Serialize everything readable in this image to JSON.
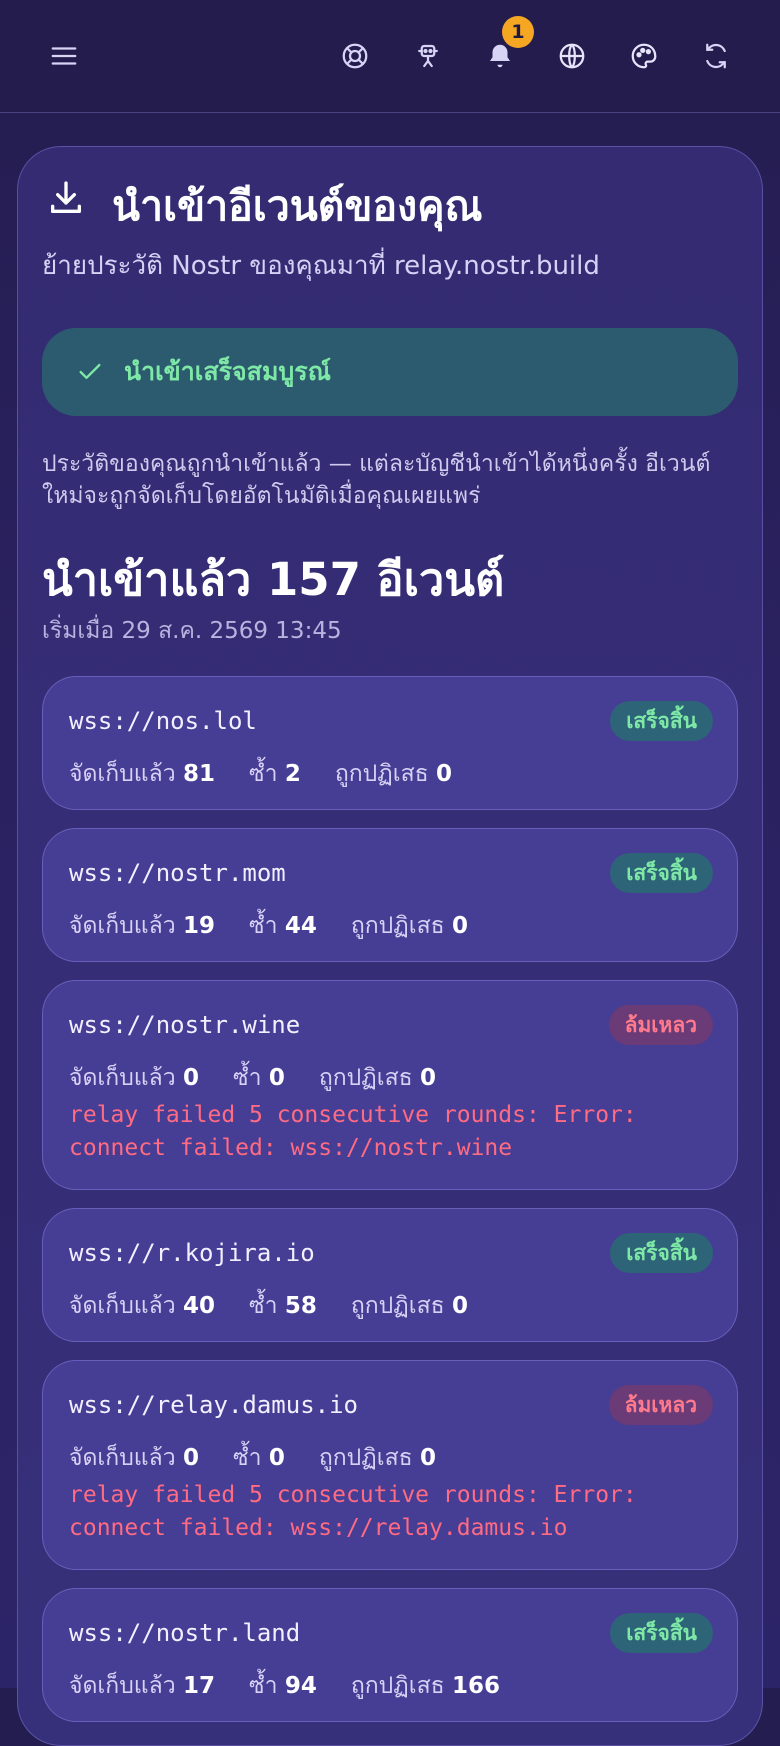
{
  "header": {
    "menu_icon": "hamburger-icon",
    "help_icon": "lifebuoy-icon",
    "bot_icon": "robot-icon",
    "notifications_icon": "bell-icon",
    "notifications_count": "1",
    "language_icon": "globe-icon",
    "theme_icon": "palette-icon",
    "refresh_icon": "refresh-icon"
  },
  "import": {
    "title": "นำเข้าอีเวนต์ของคุณ",
    "subtitle": "ย้ายประวัติ Nostr ของคุณมาที่ relay.nostr.build",
    "success_message": "นำเข้าเสร็จสมบูรณ์",
    "description": "ประวัติของคุณถูกนำเข้าแล้ว — แต่ละบัญชีนำเข้าได้หนึ่งครั้ง อีเวนต์ใหม่จะถูกจัดเก็บโดยอัตโนมัติเมื่อคุณเผยแพร่",
    "count_title": "นำเข้าแล้ว 157 อีเวนต์",
    "started_at": "เริ่มเมื่อ 29 ส.ค. 2569 13:45"
  },
  "labels": {
    "stored": "จัดเก็บแล้ว",
    "duplicate": "ซ้ำ",
    "rejected": "ถูกปฏิเสธ"
  },
  "colors": {
    "success": "#7ee8a6",
    "failure": "#ff6b82",
    "badge": "#f5a623"
  },
  "relays": [
    {
      "url": "wss://nos.lol",
      "status": "เสร็จสิ้น",
      "stored": "81",
      "duplicate": "2",
      "rejected": "0",
      "error": ""
    },
    {
      "url": "wss://nostr.mom",
      "status": "เสร็จสิ้น",
      "stored": "19",
      "duplicate": "44",
      "rejected": "0",
      "error": ""
    },
    {
      "url": "wss://nostr.wine",
      "status": "ล้มเหลว",
      "stored": "0",
      "duplicate": "0",
      "rejected": "0",
      "error": "relay failed 5 consecutive rounds: Error: connect failed: wss://nostr.wine"
    },
    {
      "url": "wss://r.kojira.io",
      "status": "เสร็จสิ้น",
      "stored": "40",
      "duplicate": "58",
      "rejected": "0",
      "error": ""
    },
    {
      "url": "wss://relay.damus.io",
      "status": "ล้มเหลว",
      "stored": "0",
      "duplicate": "0",
      "rejected": "0",
      "error": "relay failed 5 consecutive rounds: Error: connect failed: wss://relay.damus.io"
    },
    {
      "url": "wss://nostr.land",
      "status": "เสร็จสิ้น",
      "stored": "17",
      "duplicate": "94",
      "rejected": "166",
      "error": ""
    }
  ]
}
